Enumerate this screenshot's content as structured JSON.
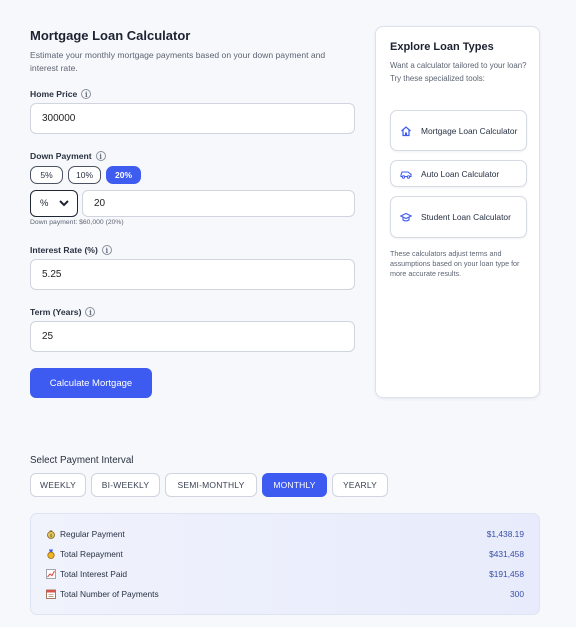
{
  "calculator": {
    "title": "Mortgage Loan Calculator",
    "subtitle": "Estimate your monthly mortgage payments based on your down payment and interest rate.",
    "home_price": {
      "label": "Home Price",
      "value": "300000"
    },
    "down_payment": {
      "label": "Down Payment",
      "presets": [
        "5%",
        "10%",
        "20%"
      ],
      "active_preset": "20%",
      "unit": "%",
      "value": "20",
      "hint": "Down payment: $60,000 (20%)"
    },
    "interest_rate": {
      "label": "Interest Rate (%)",
      "value": "5.25"
    },
    "term": {
      "label": "Term (Years)",
      "value": "25"
    },
    "calculate_label": "Calculate Mortgage"
  },
  "sidebar": {
    "title": "Explore Loan Types",
    "subtitle": "Want a calculator tailored to your loan? Try these specialized tools:",
    "items": [
      {
        "label": "Mortgage Loan Calculator",
        "icon": "home-icon"
      },
      {
        "label": "Auto Loan Calculator",
        "icon": "car-icon"
      },
      {
        "label": "Student Loan Calculator",
        "icon": "graduation-cap-icon"
      }
    ],
    "note": "These calculators adjust terms and assumptions based on your loan type for more accurate results."
  },
  "interval": {
    "title": "Select Payment Interval",
    "options": [
      "WEEKLY",
      "BI-WEEKLY",
      "SEMI-MONTHLY",
      "MONTHLY",
      "YEARLY"
    ],
    "active": "MONTHLY"
  },
  "results": [
    {
      "label": "Regular Payment",
      "value": "$1,438.19",
      "icon": "money-bag-icon"
    },
    {
      "label": "Total Repayment",
      "value": "$431,458",
      "icon": "medal-icon"
    },
    {
      "label": "Total Interest Paid",
      "value": "$191,458",
      "icon": "chart-icon"
    },
    {
      "label": "Total Number of Payments",
      "value": "300",
      "icon": "calendar-icon"
    }
  ],
  "colors": {
    "accent": "#3d5bf0",
    "result_value": "#3a4fa8"
  }
}
